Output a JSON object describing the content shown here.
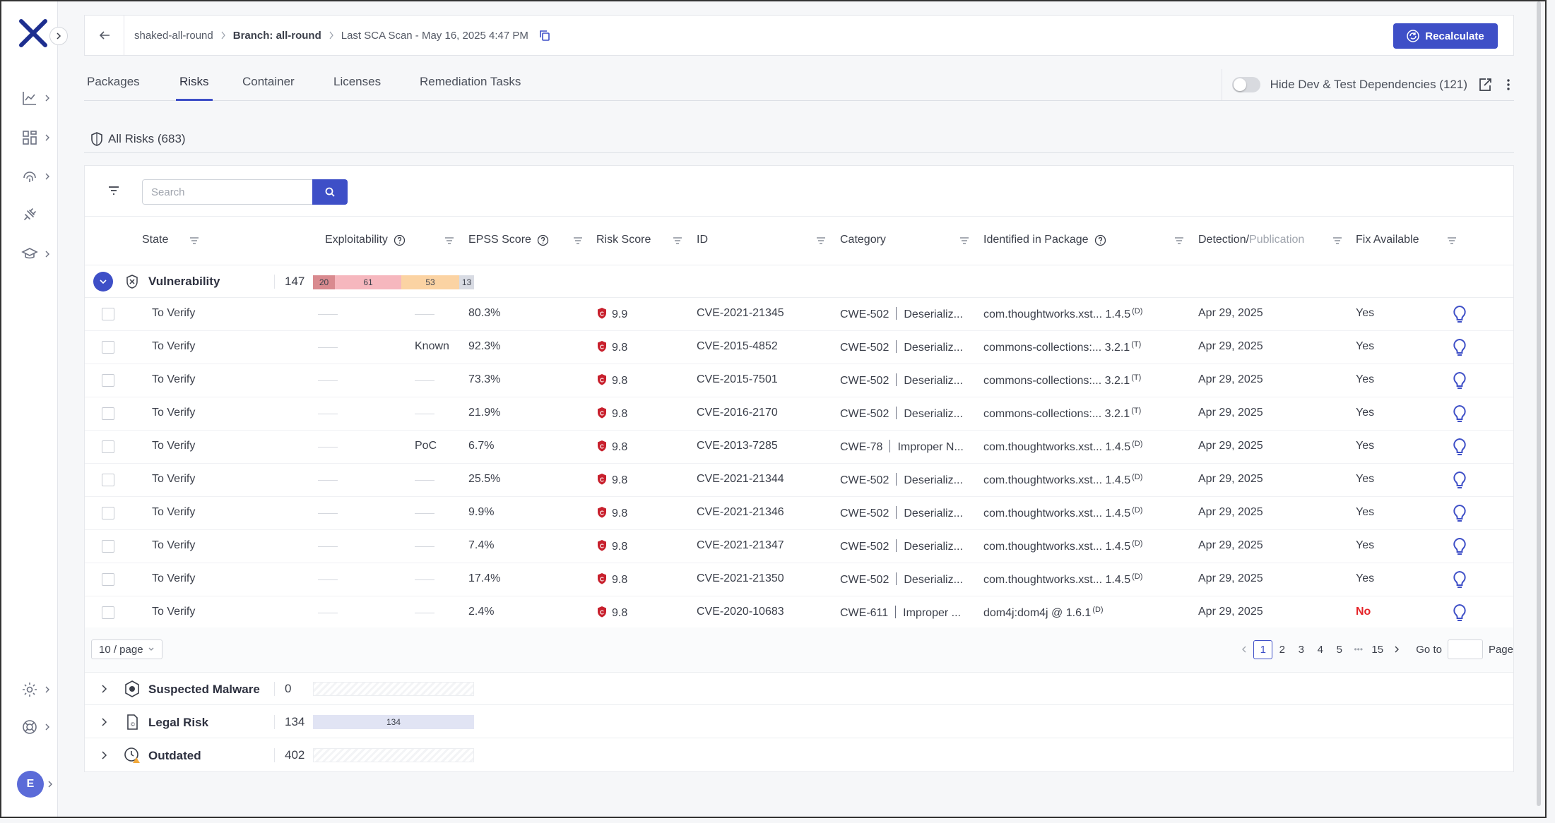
{
  "header": {
    "project": "shaked-all-round",
    "branch": "Branch: all-round",
    "scan": "Last SCA Scan - May 16, 2025 4:47 PM",
    "recalculate_label": "Recalculate"
  },
  "tabs": [
    "Packages",
    "Risks",
    "Container",
    "Licenses",
    "Remediation Tasks"
  ],
  "active_tab": "Risks",
  "hide_dev": {
    "label": "Hide Dev & Test Dependencies (121)",
    "enabled": false
  },
  "all_risks": "All Risks (683)",
  "search": {
    "placeholder": "Search"
  },
  "columns": {
    "state": "State",
    "exploitability": "Exploitability",
    "epss": "EPSS Score",
    "risk_score": "Risk Score",
    "id": "ID",
    "category": "Category",
    "package": "Identified in Package",
    "detection": "Detection",
    "slash": "/",
    "publication": "Publication",
    "fix": "Fix Available"
  },
  "vulnerability_group": {
    "label": "Vulnerability",
    "count": "147",
    "severity": {
      "critical": "20",
      "high": "61",
      "medium": "53",
      "low": "13"
    }
  },
  "rows": [
    {
      "state": "To Verify",
      "exploit": "",
      "epss": "80.3%",
      "risk": "9.9",
      "id": "CVE-2021-21345",
      "cwe": "CWE-502",
      "category": "Deserializ...",
      "pkg": "com.thoughtworks.xst... 1.4.5",
      "dep": "(D)",
      "date": "Apr 29, 2025",
      "fix": "Yes"
    },
    {
      "state": "To Verify",
      "exploit": "Known",
      "epss": "92.3%",
      "risk": "9.8",
      "id": "CVE-2015-4852",
      "cwe": "CWE-502",
      "category": "Deserializ...",
      "pkg": "commons-collections:... 3.2.1",
      "dep": "(T)",
      "date": "Apr 29, 2025",
      "fix": "Yes"
    },
    {
      "state": "To Verify",
      "exploit": "",
      "epss": "73.3%",
      "risk": "9.8",
      "id": "CVE-2015-7501",
      "cwe": "CWE-502",
      "category": "Deserializ...",
      "pkg": "commons-collections:... 3.2.1",
      "dep": "(T)",
      "date": "Apr 29, 2025",
      "fix": "Yes"
    },
    {
      "state": "To Verify",
      "exploit": "",
      "epss": "21.9%",
      "risk": "9.8",
      "id": "CVE-2016-2170",
      "cwe": "CWE-502",
      "category": "Deserializ...",
      "pkg": "commons-collections:... 3.2.1",
      "dep": "(T)",
      "date": "Apr 29, 2025",
      "fix": "Yes"
    },
    {
      "state": "To Verify",
      "exploit": "PoC",
      "epss": "6.7%",
      "risk": "9.8",
      "id": "CVE-2013-7285",
      "cwe": "CWE-78",
      "category": "Improper N...",
      "pkg": "com.thoughtworks.xst... 1.4.5",
      "dep": "(D)",
      "date": "Apr 29, 2025",
      "fix": "Yes"
    },
    {
      "state": "To Verify",
      "exploit": "",
      "epss": "25.5%",
      "risk": "9.8",
      "id": "CVE-2021-21344",
      "cwe": "CWE-502",
      "category": "Deserializ...",
      "pkg": "com.thoughtworks.xst... 1.4.5",
      "dep": "(D)",
      "date": "Apr 29, 2025",
      "fix": "Yes"
    },
    {
      "state": "To Verify",
      "exploit": "",
      "epss": "9.9%",
      "risk": "9.8",
      "id": "CVE-2021-21346",
      "cwe": "CWE-502",
      "category": "Deserializ...",
      "pkg": "com.thoughtworks.xst... 1.4.5",
      "dep": "(D)",
      "date": "Apr 29, 2025",
      "fix": "Yes"
    },
    {
      "state": "To Verify",
      "exploit": "",
      "epss": "7.4%",
      "risk": "9.8",
      "id": "CVE-2021-21347",
      "cwe": "CWE-502",
      "category": "Deserializ...",
      "pkg": "com.thoughtworks.xst... 1.4.5",
      "dep": "(D)",
      "date": "Apr 29, 2025",
      "fix": "Yes"
    },
    {
      "state": "To Verify",
      "exploit": "",
      "epss": "17.4%",
      "risk": "9.8",
      "id": "CVE-2021-21350",
      "cwe": "CWE-502",
      "category": "Deserializ...",
      "pkg": "com.thoughtworks.xst... 1.4.5",
      "dep": "(D)",
      "date": "Apr 29, 2025",
      "fix": "Yes"
    },
    {
      "state": "To Verify",
      "exploit": "",
      "epss": "2.4%",
      "risk": "9.8",
      "id": "CVE-2020-10683",
      "cwe": "CWE-611",
      "category": "Improper ...",
      "pkg": "dom4j:dom4j @ 1.6.1",
      "dep": "(D)",
      "date": "Apr 29, 2025",
      "fix": "No"
    }
  ],
  "pagination": {
    "per_page": "10 / page",
    "pages": [
      "1",
      "2",
      "3",
      "4",
      "5"
    ],
    "ellipsis": "•••",
    "last": "15",
    "goto": "Go to",
    "page_label": "Page"
  },
  "other_groups": [
    {
      "label": "Suspected Malware",
      "count": "0"
    },
    {
      "label": "Legal Risk",
      "count": "134",
      "bar": "134"
    },
    {
      "label": "Outdated",
      "count": "402"
    }
  ],
  "user_initial": "E",
  "colors": {
    "accent": "#3e4fc7",
    "critical": "#d98a8f",
    "high": "#f6b7be",
    "medium": "#fbd3a3",
    "low": "#d8dbe3",
    "risk_red": "#c8202d",
    "no_red": "#e5252a"
  }
}
